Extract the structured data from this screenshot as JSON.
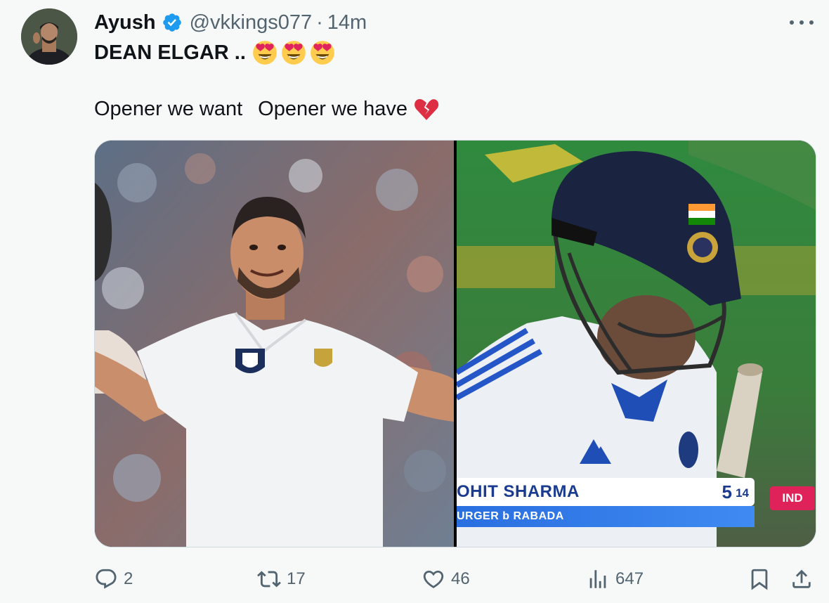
{
  "author": {
    "display_name": "Ayush",
    "handle": "@vkkings077",
    "separator": "·",
    "time": "14m"
  },
  "tweet": {
    "line1": "DEAN ELGAR ..",
    "line2_part1": "Opener we want",
    "line2_part2": "Opener we have"
  },
  "media": {
    "scoreboard": {
      "player": "OHIT SHARMA",
      "runs": "5",
      "balls": "14",
      "dismissal": "URGER b RABADA",
      "team": "IND"
    }
  },
  "actions": {
    "replies": "2",
    "retweets": "17",
    "likes": "46",
    "views": "647"
  },
  "colors": {
    "verified": "#1d9bf0",
    "secondary_text": "#536471",
    "score_blue": "#1a3b8f",
    "team_badge": "#e0225a"
  }
}
